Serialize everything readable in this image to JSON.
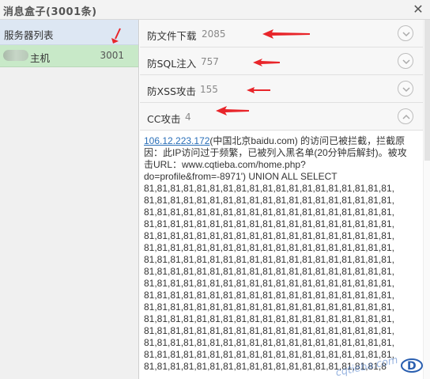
{
  "window": {
    "title": "消息盒子(3001条)",
    "close_glyph": "✕"
  },
  "sidebar": {
    "header": "服务器列表",
    "servers": [
      {
        "name": "主机",
        "count": "3001"
      }
    ]
  },
  "categories": [
    {
      "name": "防文件下载",
      "count": "2085",
      "expanded": false
    },
    {
      "name": "防SQL注入",
      "count": "757",
      "expanded": false
    },
    {
      "name": "防XSS攻击",
      "count": "155",
      "expanded": false
    },
    {
      "name": "CC攻击",
      "count": "4",
      "expanded": true
    }
  ],
  "detail": {
    "ip": "106.12.223.172",
    "line1_rest": "(中国北京baidu.com) 的访问已被拦截，拦截原",
    "line2": "因：此IP访问过于频繁，已被列入黑名单(20分钟后解封)。被攻",
    "line3": "击URL：www.cqtieba.com/home.php?",
    "line4": "do=profile&from=-8971') UNION ALL SELECT",
    "numrow": "81,81,81,81,81,81,81,81,81,81,81,81,81,81,81,81,81,81,81,",
    "numrow_last": "81,81,81,81,81,81,81,81,81,81,81,81,81,81,81,81,81,81,8"
  },
  "watermark": {
    "text": "cqtieba.com"
  },
  "colors": {
    "sidebar_header_bg": "#dde7f3",
    "selected_server_bg": "#c8e9c8",
    "link": "#2a6fb8",
    "annotation_arrow": "#e8252a"
  }
}
